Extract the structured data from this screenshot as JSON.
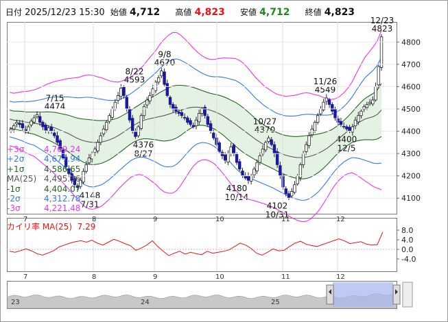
{
  "header": {
    "date_label": "日付",
    "datetime": "2025/12/23 15:30",
    "open_label": "始値",
    "open": "4,712",
    "high_label": "高値",
    "high": "4,823",
    "low_label": "安値",
    "low": "4,712",
    "close_label": "終値",
    "close": "4,823"
  },
  "legend": [
    {
      "name": "+3σ",
      "value": "4,769.24",
      "color": "#ee33ee"
    },
    {
      "name": "+2σ",
      "value": "4,677.94",
      "color": "#3377ee"
    },
    {
      "name": "+1σ",
      "value": "4,586.65",
      "color": "#226622"
    },
    {
      "name": "MA(25)",
      "value": "4,495.36",
      "color": "#555555"
    },
    {
      "name": "-1σ",
      "value": "4,404.07",
      "color": "#226622"
    },
    {
      "name": "-2σ",
      "value": "4,312.78",
      "color": "#3377ee"
    },
    {
      "name": "-3σ",
      "value": "4,221.48",
      "color": "#ee33ee"
    }
  ],
  "indicator": {
    "label": "カイリ率 MA(25)",
    "value": "7.29",
    "ticks": [
      "8.0",
      "4.0",
      "0.0",
      "-4.0"
    ]
  },
  "colors": {
    "up": "#ffffff",
    "down": "#1a1aa0",
    "plus3": "#ee33ee",
    "plus2": "#3377ee",
    "plus1": "#226622",
    "ma": "#555555",
    "band_fill": "#e4f2e4",
    "deviation": "#ee1111"
  },
  "chart_data": {
    "type": "candlestick",
    "y_ticks": [
      4100,
      4200,
      4300,
      4400,
      4500,
      4600,
      4700,
      4800
    ],
    "ylim": [
      4030,
      4890
    ],
    "month_labels": [
      "7",
      "8",
      "9",
      "10",
      "11",
      "12"
    ],
    "nav_labels": [
      "23",
      "24",
      "25"
    ],
    "annotations": [
      {
        "date": "7/15",
        "price": 4474,
        "side": "high"
      },
      {
        "date": "7/31",
        "price": 4148,
        "side": "low"
      },
      {
        "date": "8/22",
        "price": 4593,
        "side": "high"
      },
      {
        "date": "8/27",
        "price": 4376,
        "side": "low"
      },
      {
        "date": "9/8",
        "price": 4670,
        "side": "high"
      },
      {
        "date": "10/14",
        "price": 4180,
        "side": "low"
      },
      {
        "date": "10/27",
        "price": 4370,
        "side": "high"
      },
      {
        "date": "10/31",
        "price": 4102,
        "side": "low"
      },
      {
        "date": "11/26",
        "price": 4549,
        "side": "high"
      },
      {
        "date": "12/5",
        "price": 4400,
        "side": "low"
      },
      {
        "date": "12/23",
        "price": 4823,
        "side": "high"
      }
    ],
    "close_series": [
      4410,
      4425,
      4440,
      4430,
      4415,
      4400,
      4420,
      4445,
      4460,
      4474,
      4440,
      4420,
      4405,
      4415,
      4400,
      4380,
      4350,
      4320,
      4280,
      4240,
      4210,
      4180,
      4160,
      4148,
      4180,
      4220,
      4250,
      4280,
      4300,
      4320,
      4350,
      4380,
      4410,
      4440,
      4470,
      4500,
      4530,
      4560,
      4593,
      4560,
      4500,
      4450,
      4400,
      4376,
      4420,
      4470,
      4510,
      4540,
      4560,
      4590,
      4620,
      4640,
      4670,
      4610,
      4560,
      4520,
      4500,
      4490,
      4480,
      4470,
      4460,
      4440,
      4430,
      4420,
      4450,
      4480,
      4500,
      4470,
      4430,
      4400,
      4370,
      4340,
      4310,
      4290,
      4270,
      4300,
      4330,
      4300,
      4260,
      4230,
      4200,
      4190,
      4180,
      4200,
      4230,
      4260,
      4290,
      4320,
      4350,
      4370,
      4340,
      4300,
      4250,
      4200,
      4150,
      4120,
      4102,
      4130,
      4160,
      4200,
      4250,
      4300,
      4340,
      4380,
      4410,
      4440,
      4470,
      4500,
      4530,
      4549,
      4520,
      4490,
      4460,
      4440,
      4430,
      4420,
      4410,
      4400,
      4420,
      4450,
      4470,
      4490,
      4510,
      4520,
      4530,
      4540,
      4600,
      4690,
      4823
    ],
    "ma_series": [
      4455,
      4450,
      4448,
      4445,
      4440,
      4438,
      4436,
      4432,
      4428,
      4425,
      4420,
      4414,
      4406,
      4398,
      4390,
      4380,
      4370,
      4362,
      4356,
      4352,
      4350,
      4350,
      4352,
      4356,
      4362,
      4370,
      4380,
      4392,
      4405,
      4418,
      4430,
      4440,
      4448,
      4454,
      4458,
      4462,
      4466,
      4470,
      4476,
      4482,
      4488,
      4494,
      4500,
      4505,
      4508,
      4508,
      4505,
      4500,
      4494,
      4488,
      4480,
      4470,
      4458,
      4445,
      4432,
      4418,
      4404,
      4390,
      4376,
      4362,
      4350,
      4338,
      4328,
      4318,
      4308,
      4300,
      4293,
      4288,
      4284,
      4282,
      4282,
      4284,
      4288,
      4294,
      4302,
      4312,
      4324,
      4338,
      4354,
      4370,
      4386,
      4402,
      4418,
      4432,
      4444,
      4454,
      4460,
      4465,
      4475,
      4495
    ],
    "sigma_series": [
      40,
      40,
      42,
      44,
      46,
      48,
      50,
      54,
      58,
      62,
      66,
      70,
      74,
      78,
      82,
      86,
      90,
      94,
      98,
      100,
      100,
      98,
      96,
      92,
      88,
      84,
      80,
      78,
      76,
      75,
      76,
      78,
      82,
      88,
      94,
      100,
      108,
      114,
      118,
      120,
      118,
      112,
      104,
      96,
      88,
      82,
      78,
      76,
      76,
      78,
      82,
      86,
      90,
      94,
      98,
      100,
      100,
      98,
      95,
      92,
      90,
      88,
      87,
      86,
      86,
      87,
      88,
      90,
      92,
      94,
      96,
      96,
      94,
      90,
      86,
      80,
      74,
      68,
      64,
      62,
      62,
      64,
      68,
      76,
      84,
      92,
      98,
      104,
      110,
      119
    ],
    "deviation_series": [
      -0.8,
      -1.2,
      -0.5,
      0.2,
      -0.6,
      -1.8,
      -2.4,
      -1.5,
      -0.6,
      1.0,
      1.8,
      2.6,
      3.2,
      3.6,
      3.0,
      3.8,
      2.6,
      1.8,
      3.0,
      4.2,
      3.4,
      2.4,
      1.6,
      -0.4,
      0.6,
      1.8,
      3.6,
      1.2,
      -0.8,
      -2.6,
      -1.6,
      -0.8,
      -2.0,
      -1.2,
      -1.8,
      -2.2,
      -0.8,
      -1.6,
      -1.2,
      -0.8,
      -0.2,
      1.2,
      2.6,
      1.8,
      0.4,
      -1.6,
      -2.4,
      -1.2,
      0.2,
      -0.6,
      -0.4,
      1.2,
      2.6,
      3.4,
      2.2,
      1.6,
      1.2,
      2.0,
      2.8,
      3.6,
      4.4,
      3.6,
      2.4,
      2.8,
      3.2,
      2.2,
      1.8,
      2.0,
      7.29
    ]
  }
}
